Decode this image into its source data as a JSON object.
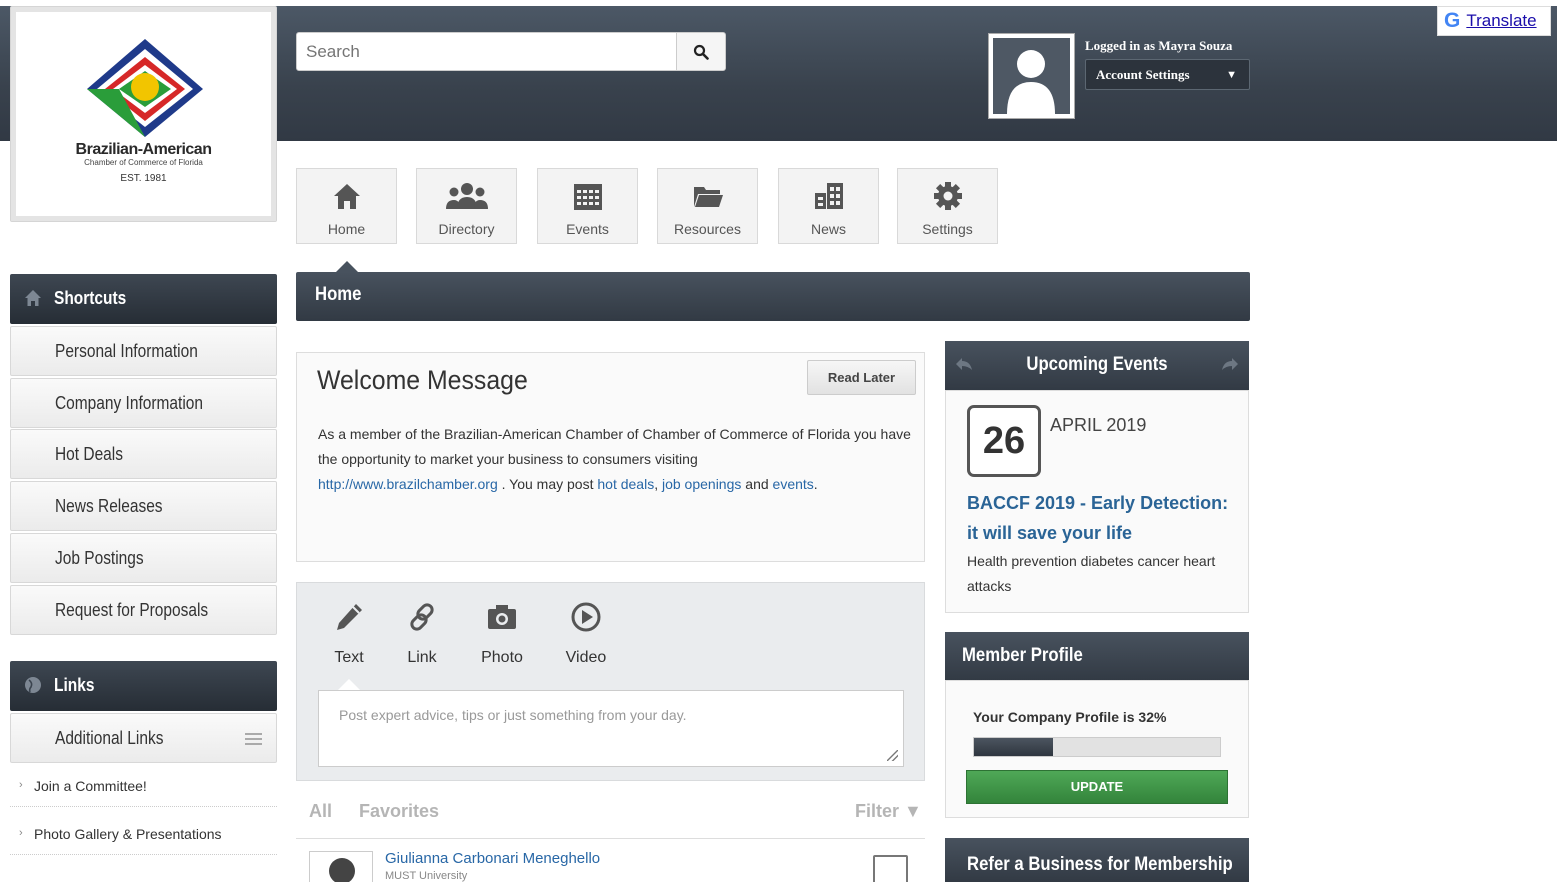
{
  "logo": {
    "name": "Brazilian-American",
    "subtitle": "Chamber of Commerce of Florida",
    "est": "EST. 1981"
  },
  "search": {
    "placeholder": "Search"
  },
  "user": {
    "logged_in": "Logged in as Mayra Souza",
    "account_settings": "Account Settings"
  },
  "translate": {
    "label": "Translate"
  },
  "nav": [
    {
      "label": "Home",
      "icon": "home-icon"
    },
    {
      "label": "Directory",
      "icon": "users-icon"
    },
    {
      "label": "Events",
      "icon": "calendar-icon"
    },
    {
      "label": "Resources",
      "icon": "folder-icon"
    },
    {
      "label": "News",
      "icon": "news-icon"
    },
    {
      "label": "Settings",
      "icon": "gear-icon"
    }
  ],
  "page_title": "Home",
  "sidebar": {
    "shortcuts_title": "Shortcuts",
    "shortcuts": [
      "Personal Information",
      "Company Information",
      "Hot Deals",
      "News Releases",
      "Job Postings",
      "Request for Proposals"
    ],
    "links_title": "Links",
    "additional_links": "Additional Links",
    "links": [
      "Join a Committee!",
      "Photo Gallery & Presentations"
    ]
  },
  "welcome": {
    "title": "Welcome Message",
    "read_later": "Read Later",
    "text1": "As a member of the Brazilian-American Chamber of Chamber of Commerce of Florida you have the opportunity to market your business to consumers visiting",
    "url": "http://www.brazilchamber.org",
    "text2": ". You may post",
    "link_hot_deals": "hot deals",
    "comma": ",",
    "link_jobs": "job openings",
    "and": "and",
    "link_events": "events",
    "period": "."
  },
  "post": {
    "tabs": [
      {
        "label": "Text",
        "icon": "pencil-icon"
      },
      {
        "label": "Link",
        "icon": "link-icon"
      },
      {
        "label": "Photo",
        "icon": "camera-icon"
      },
      {
        "label": "Video",
        "icon": "play-icon"
      }
    ],
    "placeholder": "Post expert advice, tips or just something from your day."
  },
  "feed": {
    "tab_all": "All",
    "tab_favorites": "Favorites",
    "filter": "Filter ▼",
    "first_author": "Giulianna Carbonari Meneghello",
    "first_org": "MUST University"
  },
  "events": {
    "title": "Upcoming Events",
    "day": "26",
    "month": "APRIL 2019",
    "event_title": "BACCF 2019 - Early Detection: it will save your life",
    "event_desc": "Health prevention diabetes cancer heart attacks"
  },
  "member_profile": {
    "title": "Member Profile",
    "text": "Your Company Profile is 32%",
    "percent": 32,
    "update": "UPDATE"
  },
  "refer": {
    "title": "Refer a Business for Membership"
  },
  "colors": {
    "header": "#39424d",
    "link": "#2867a6",
    "update_green": "#3d9645"
  }
}
